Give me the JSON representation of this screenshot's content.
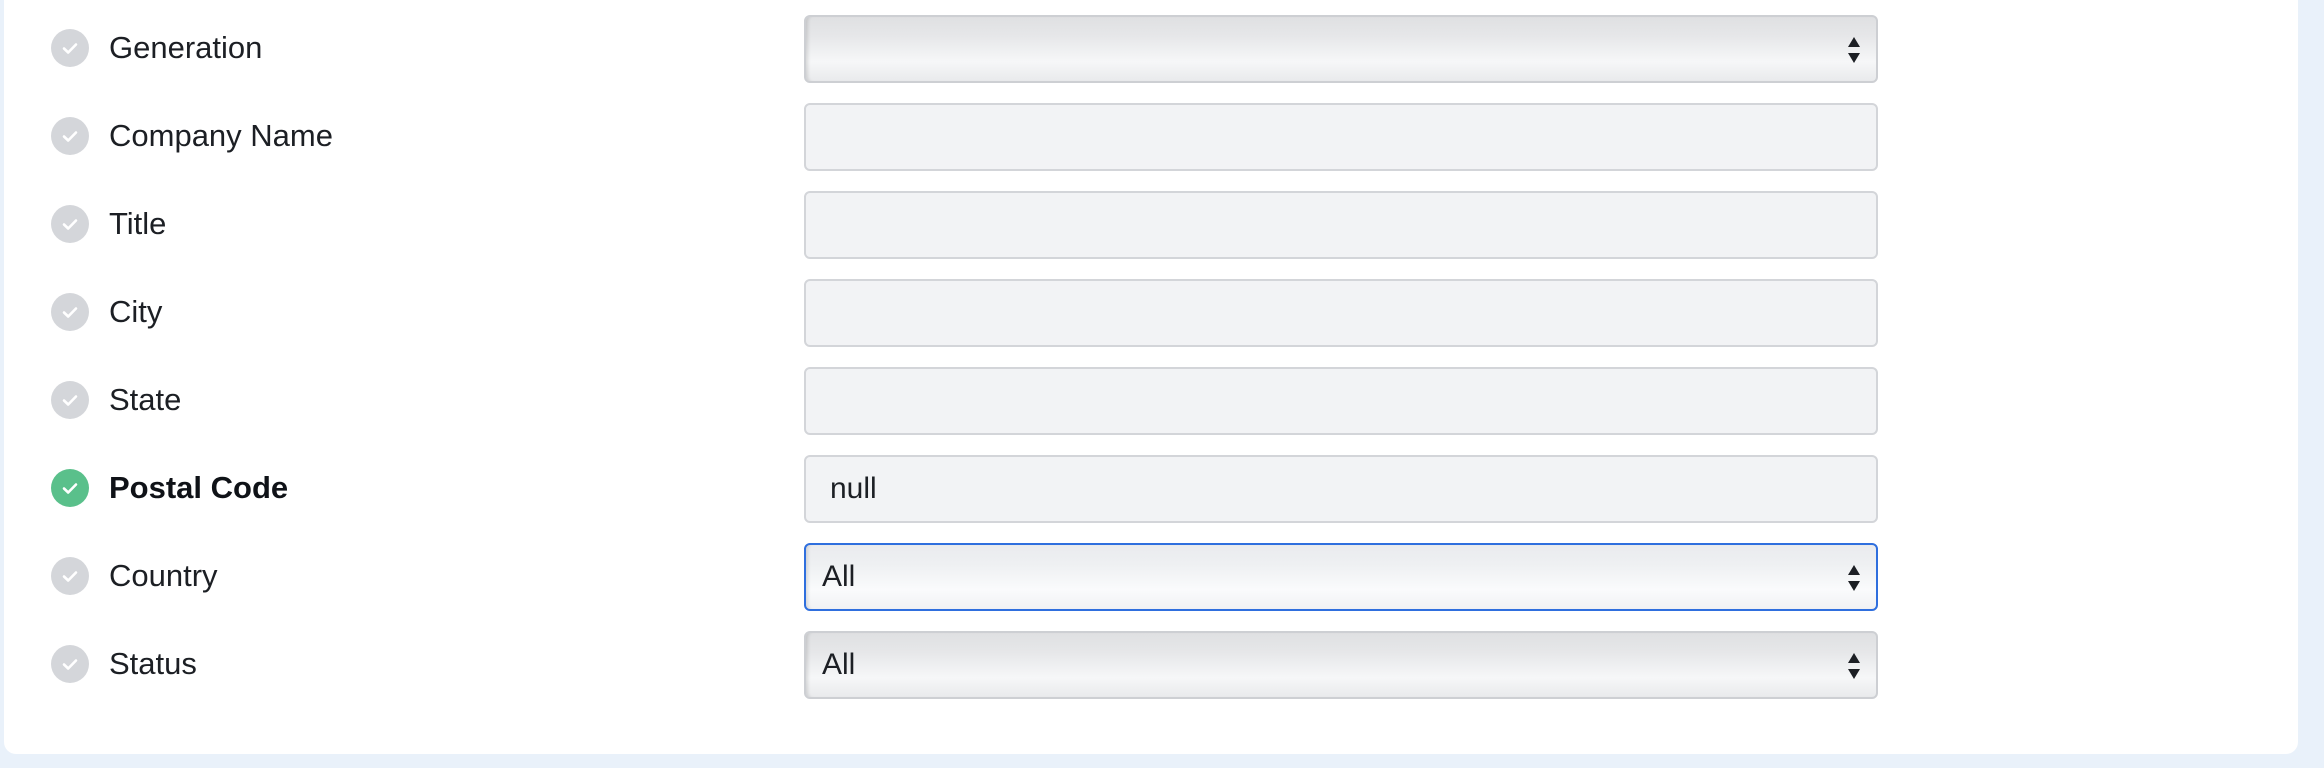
{
  "filters": [
    {
      "label": "Generation",
      "kind": "select",
      "value": "",
      "active": false,
      "focused": false
    },
    {
      "label": "Company Name",
      "kind": "text",
      "value": "",
      "active": false
    },
    {
      "label": "Title",
      "kind": "text",
      "value": "",
      "active": false
    },
    {
      "label": "City",
      "kind": "text",
      "value": "",
      "active": false
    },
    {
      "label": "State",
      "kind": "text",
      "value": "",
      "active": false
    },
    {
      "label": "Postal Code",
      "kind": "text",
      "value": "null",
      "active": true
    },
    {
      "label": "Country",
      "kind": "select",
      "value": "All",
      "active": false,
      "focused": true
    },
    {
      "label": "Status",
      "kind": "select",
      "value": "All",
      "active": false,
      "focused": false
    }
  ],
  "icons": {
    "check": "check-icon",
    "select_arrows": "updown-arrows-icon"
  },
  "colors": {
    "active_check": "#5ac08b",
    "inactive_check": "#d4d6da",
    "focus_border": "#2f6fde",
    "page_background": "#e9f1fa"
  }
}
